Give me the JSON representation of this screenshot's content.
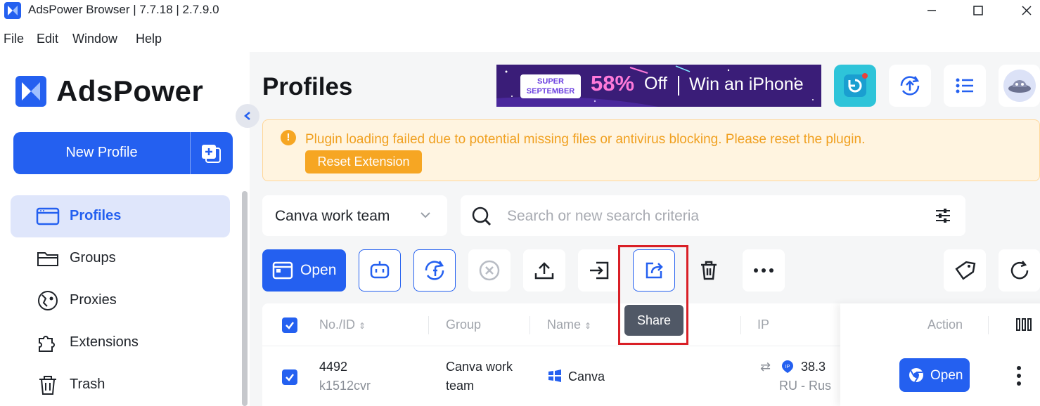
{
  "window": {
    "title": "AdsPower Browser | 7.7.18 | 2.7.9.0"
  },
  "menu": [
    "File",
    "Edit",
    "Window",
    "Help"
  ],
  "sidebar": {
    "brand": "AdsPower",
    "new_profile_label": "New Profile",
    "items": [
      {
        "label": "Profiles",
        "icon": "profiles-icon",
        "active": true
      },
      {
        "label": "Groups",
        "icon": "folder-icon"
      },
      {
        "label": "Proxies",
        "icon": "proxy-icon"
      },
      {
        "label": "Extensions",
        "icon": "puzzle-icon"
      },
      {
        "label": "Trash",
        "icon": "trash-icon"
      }
    ]
  },
  "header": {
    "title": "Profiles",
    "banner": {
      "super_line1": "SUPER",
      "super_line2": "SEPTEMBER",
      "percent": "58%",
      "off": "Off",
      "win": "Win an iPhone"
    }
  },
  "alert": {
    "message": "Plugin loading failed due to potential missing files or antivirus blocking. Please reset the plugin.",
    "button": "Reset Extension"
  },
  "filters": {
    "group_value": "Canva work team",
    "search_placeholder": "Search or new search criteria"
  },
  "toolbar": {
    "open_label": "Open",
    "tooltip": "Share"
  },
  "table": {
    "columns": [
      "No./ID",
      "Group",
      "Name",
      "IP",
      "Action"
    ],
    "rows": [
      {
        "no": "4492",
        "id": "k1512cvr",
        "group_line1": "Canva work",
        "group_line2": "team",
        "name": "Canva",
        "ip": "38.3",
        "ip_region": "RU - Rus",
        "open_label": "Open"
      }
    ]
  },
  "colors": {
    "accent": "#2460f0",
    "warning": "#f6a623",
    "highlight": "#d91f26"
  }
}
